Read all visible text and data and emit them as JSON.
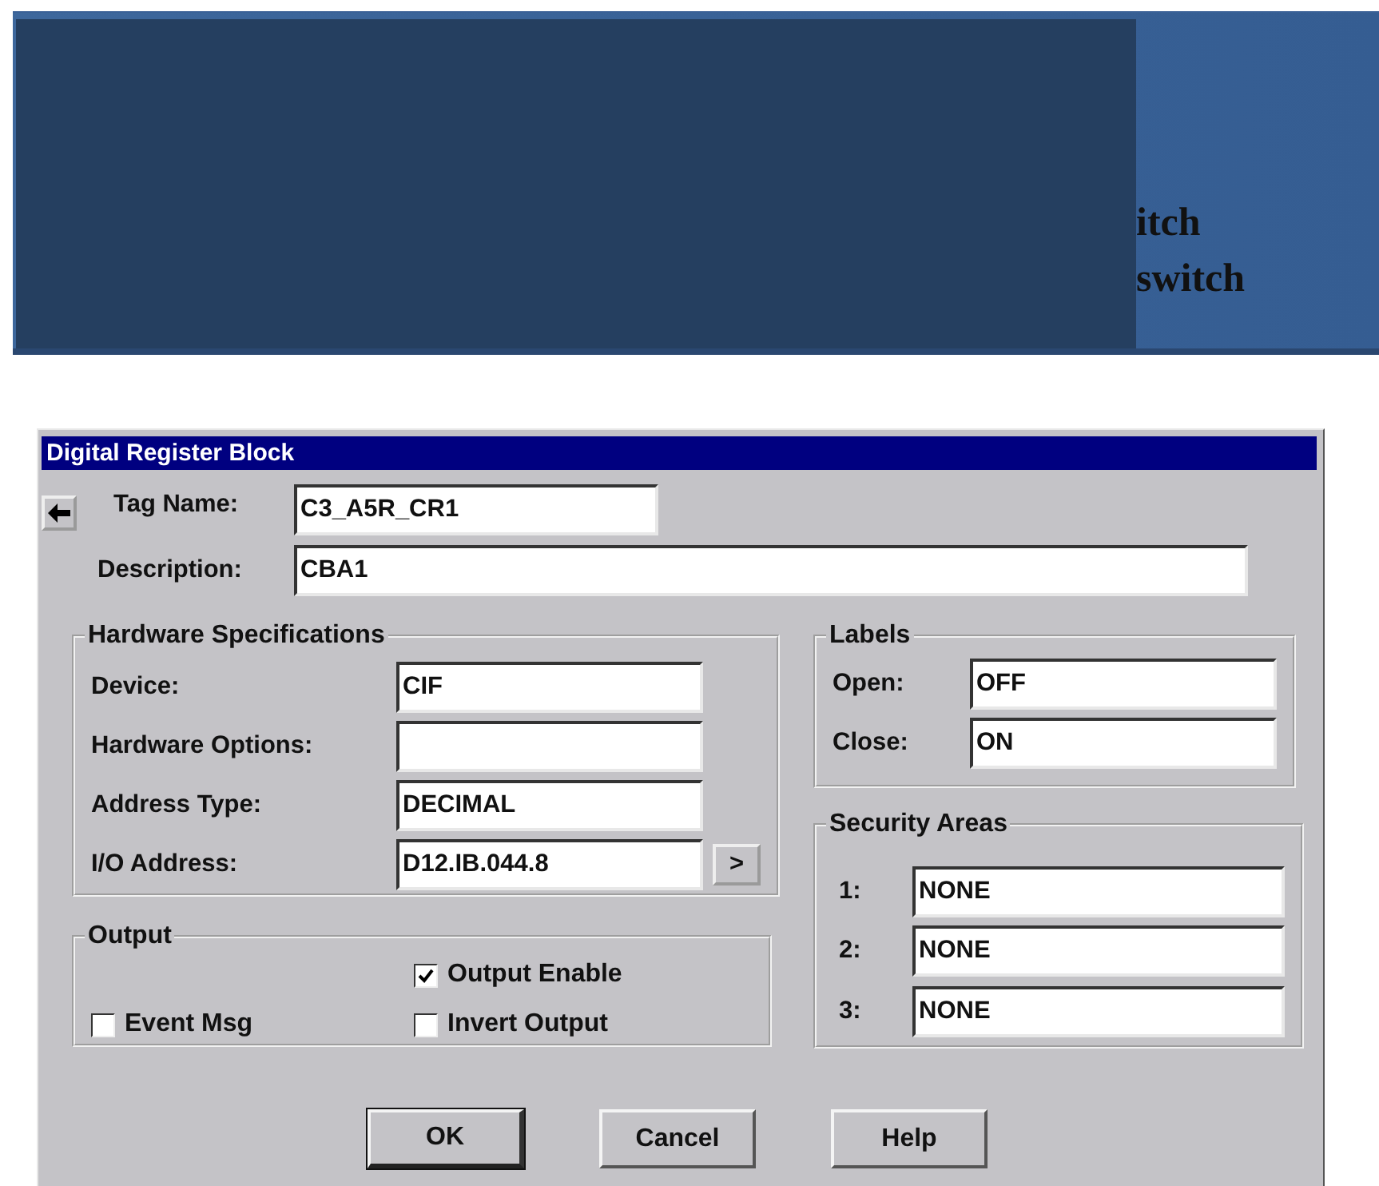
{
  "banner": {
    "lines": [
      "itch",
      "switch"
    ]
  },
  "window": {
    "title": "Digital Register Block"
  },
  "tag_name": {
    "label": "Tag Name:",
    "value": "C3_A5R_CR1"
  },
  "description": {
    "label": "Description:",
    "value": "CBA1"
  },
  "hardware": {
    "title": "Hardware Specifications",
    "fields": [
      {
        "label": "Device:",
        "value": "CIF"
      },
      {
        "label": "Hardware Options:"
      },
      {
        "label": "Address Type:",
        "value": "DECIMAL"
      },
      {
        "label": "I/O Address:",
        "value": "D12.IB.044.8",
        "button": ">"
      }
    ]
  },
  "output": {
    "title": "Output",
    "checkboxes": [
      {
        "label": "Output Enable",
        "checked": true
      },
      {
        "label": "Event Msg",
        "checked": false
      },
      {
        "label": "Invert Output",
        "checked": false
      }
    ]
  },
  "labels": {
    "title": "Labels",
    "fields": [
      {
        "label": "Open:",
        "value": "OFF"
      },
      {
        "label": "Close:",
        "value": "ON"
      }
    ]
  },
  "security_areas": {
    "title": "Security Areas",
    "fields": [
      {
        "label": "1:",
        "value": "NONE"
      },
      {
        "label": "2:",
        "value": "NONE"
      },
      {
        "label": "3:",
        "value": "NONE"
      }
    ]
  },
  "buttons": [
    {
      "label": "OK",
      "default": true
    },
    {
      "label": "Cancel",
      "default": false
    },
    {
      "label": "Help",
      "default": false
    }
  ]
}
